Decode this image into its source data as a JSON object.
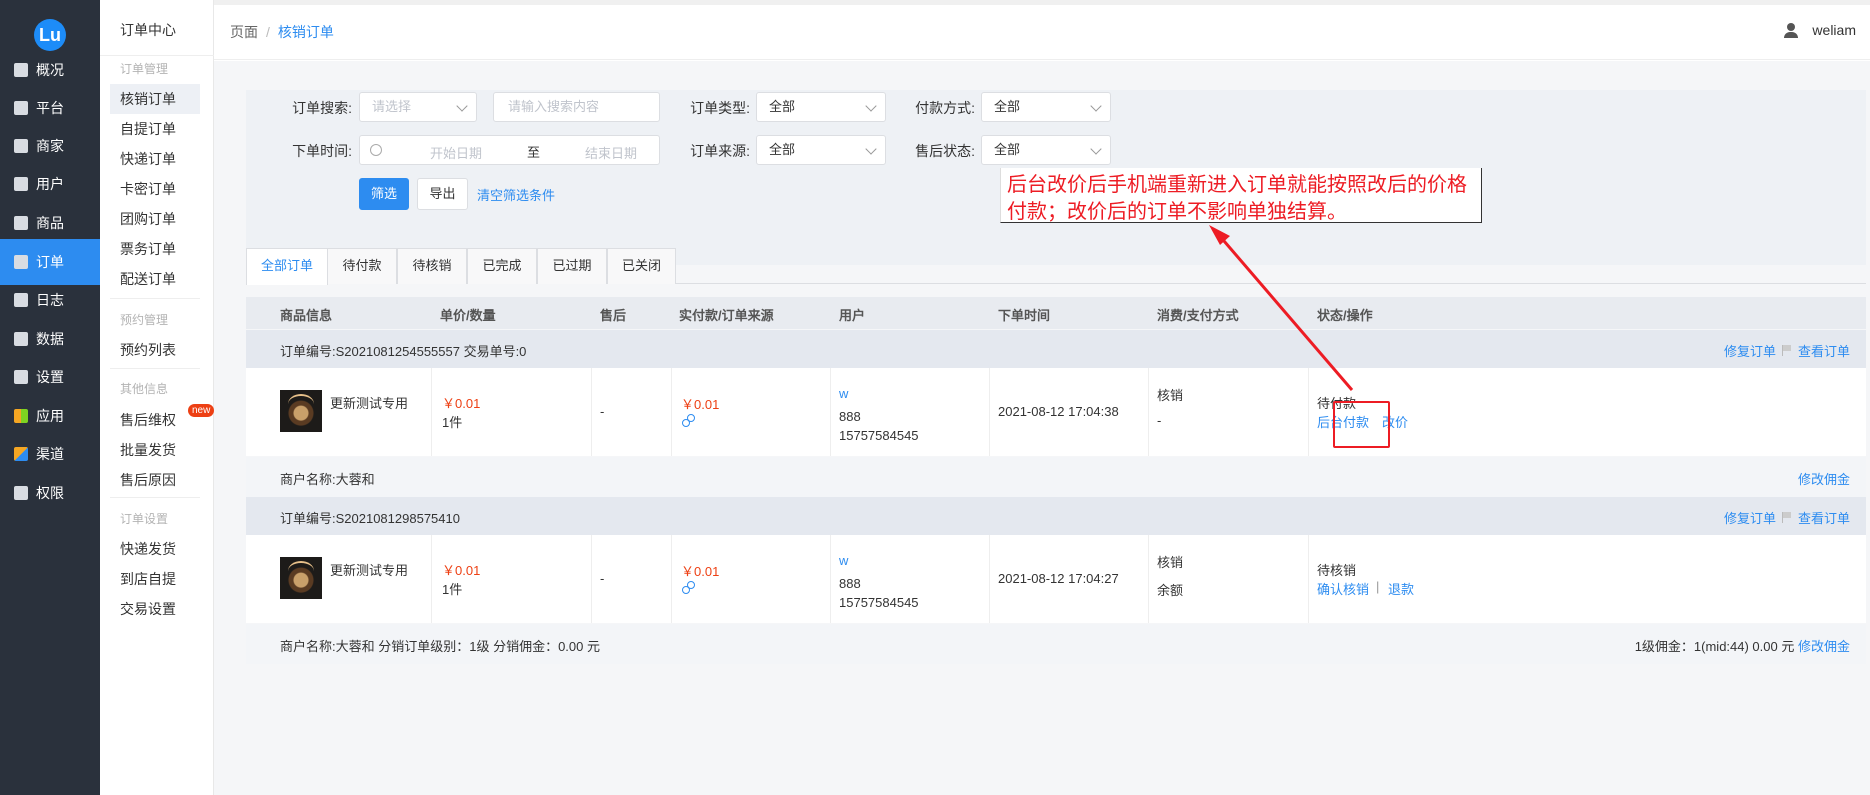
{
  "nav": {
    "logo": "Lu",
    "items": [
      {
        "label": "概况",
        "icon": "dashboard-icon"
      },
      {
        "label": "平台",
        "icon": "monitor-icon"
      },
      {
        "label": "商家",
        "icon": "store-icon"
      },
      {
        "label": "用户",
        "icon": "user-icon"
      },
      {
        "label": "商品",
        "icon": "goods-icon"
      },
      {
        "label": "订单",
        "icon": "order-icon"
      },
      {
        "label": "日志",
        "icon": "log-icon"
      },
      {
        "label": "数据",
        "icon": "chart-icon"
      },
      {
        "label": "设置",
        "icon": "gear-icon"
      },
      {
        "label": "应用",
        "icon": "apps-icon"
      },
      {
        "label": "渠道",
        "icon": "cube-icon"
      },
      {
        "label": "权限",
        "icon": "lock-icon"
      }
    ],
    "active_index": 5
  },
  "subnav": {
    "title": "订单中心",
    "groups": [
      "订单管理",
      "预约管理",
      "其他信息",
      "订单设置"
    ],
    "order_items": [
      "核销订单",
      "自提订单",
      "快递订单",
      "卡密订单",
      "团购订单",
      "票务订单",
      "配送订单"
    ],
    "reserve_items": [
      "预约列表"
    ],
    "other_items": [
      "售后维权",
      "批量发货",
      "售后原因"
    ],
    "setting_items": [
      "快递发货",
      "到店自提",
      "交易设置"
    ],
    "new_badge": "new"
  },
  "header": {
    "breadcrumb_root": "页面",
    "breadcrumb_sep": "/",
    "breadcrumb_current": "核销订单",
    "username": "weliam"
  },
  "filter": {
    "search_label": "订单搜索:",
    "search_select_placeholder": "请选择",
    "search_input_placeholder": "请输入搜索内容",
    "order_type_label": "订单类型:",
    "order_type_value": "全部",
    "pay_method_label": "付款方式:",
    "pay_method_value": "全部",
    "time_label": "下单时间:",
    "date_start_placeholder": "开始日期",
    "date_to": "至",
    "date_end_placeholder": "结束日期",
    "source_label": "订单来源:",
    "source_value": "全部",
    "aftersale_label": "售后状态:",
    "aftersale_value": "全部",
    "filter_button": "筛选",
    "export_button": "导出",
    "clear_link": "清空筛选条件"
  },
  "annotation": {
    "text": "后台改价后手机端重新进入订单就能按照改后的价格付款；改价后的订单不影响单独结算。",
    "color": "#ed1c24"
  },
  "tabs": [
    "全部订单",
    "待付款",
    "待核销",
    "已完成",
    "已过期",
    "已关闭"
  ],
  "table": {
    "headers": [
      "商品信息",
      "单价/数量",
      "售后",
      "实付款/订单来源",
      "用户",
      "下单时间",
      "消费/支付方式",
      "状态/操作"
    ],
    "orders": [
      {
        "order_no": "订单编号:S2021081254555557  交易单号:0",
        "repair": "修复订单",
        "view": "查看订单",
        "product": "更新测试专用",
        "price": "￥0.01",
        "qty": "1件",
        "aftersale": "-",
        "paid": "￥0.01",
        "user_name": "w",
        "user_id": "888",
        "user_phone": "15757584545",
        "time": "2021-08-12 17:04:38",
        "consume": "核销",
        "pay_way": "-",
        "status": "待付款",
        "action1": "后台付款",
        "action2": "改价",
        "merchant": "商户名称:大蓉和",
        "merchant_right": "",
        "merchant_link": "修改佣金"
      },
      {
        "order_no": "订单编号:S2021081298575410",
        "repair": "修复订单",
        "view": "查看订单",
        "product": "更新测试专用",
        "price": "￥0.01",
        "qty": "1件",
        "aftersale": "-",
        "paid": "￥0.01",
        "user_name": "w",
        "user_id": "888",
        "user_phone": "15757584545",
        "time": "2021-08-12 17:04:27",
        "consume": "核销",
        "pay_way": "余额",
        "status": "待核销",
        "action1": "确认核销",
        "action_sep": "|",
        "action2": "退款",
        "merchant": "商户名称:大蓉和 分销订单级别：1级 分销佣金：0.00 元",
        "merchant_right": "1级佣金：1(mid:44) 0.00 元",
        "merchant_link": "修改佣金"
      }
    ]
  }
}
